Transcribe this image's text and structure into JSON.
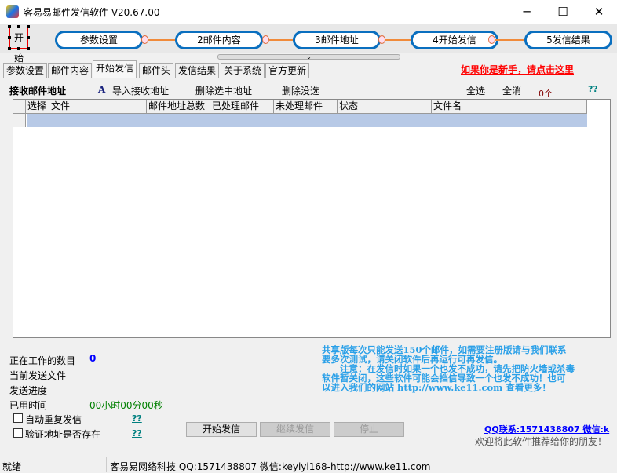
{
  "window": {
    "title": "客易易邮件发信软件 V20.67.00",
    "minimize": "─",
    "maximize": "☐",
    "close": "✕"
  },
  "flow": {
    "start": "开始",
    "steps": [
      "参数设置",
      "2邮件内容",
      "3邮件地址",
      "4开始发信",
      "5发信结果"
    ]
  },
  "tabs": [
    "参数设置",
    "邮件内容",
    "开始发信",
    "邮件头",
    "发信结果",
    "关于系统",
    "官方更新"
  ],
  "active_tab": "开始发信",
  "newbie_link": "如果你是新手，请点击这里",
  "toolbar": {
    "title": "接收邮件地址",
    "import_icon": "A",
    "import": "导入接收地址",
    "delete_selected": "删除选中地址",
    "delete_unselected": "删除没选",
    "select_all": "全选",
    "deselect_all": "全消",
    "count": "0个",
    "help": "??"
  },
  "grid": {
    "columns": [
      "选择",
      "文件",
      "邮件地址总数",
      "已处理邮件",
      "未处理邮件",
      "状态",
      "文件名"
    ]
  },
  "status": {
    "working_label": "正在工作的数目",
    "working_value": "0",
    "current_file_label": "当前发送文件",
    "progress_label": "发送进度",
    "elapsed_label": "已用时间",
    "elapsed_value": "00小时00分00秒"
  },
  "options": [
    {
      "label": "自动重复发信",
      "checked": false,
      "help": "??"
    },
    {
      "label": "验证地址是否存在",
      "checked": false,
      "help": "??"
    }
  ],
  "buttons": {
    "start": "开始发信",
    "resume": "继续发信",
    "stop": "停止"
  },
  "notice": [
    "共享版每次只能发送150个邮件，如需要注册版请与我们联系",
    "要多次测试，请关闭软件后再运行可再发信。",
    "　　注意：在发信时如果一个也发不成功，请先把防火墙或杀毒",
    "软件暂关闭，这些软件可能会挡信导致一个也发不成功！也可",
    "以进入我们的网站 http://www.ke11.com 查看更多！"
  ],
  "contact": "QQ联系:1571438807 微信:k",
  "recommend": "欢迎将此软件推荐给你的朋友！",
  "statusbar": {
    "state": "就绪",
    "info": "客易易网络科技 QQ:1571438807 微信:keyiyi168-http://www.ke11.com"
  }
}
